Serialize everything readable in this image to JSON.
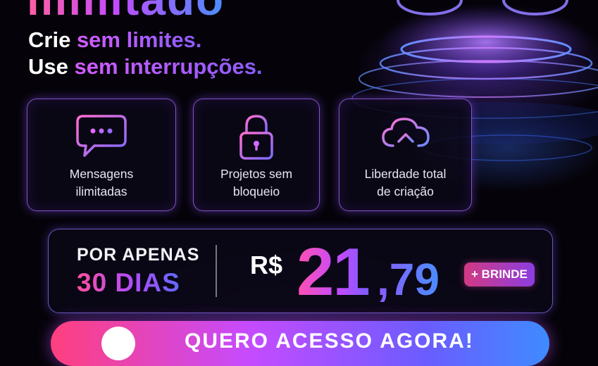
{
  "logo": {
    "text": "ilimitado"
  },
  "headline": {
    "line1_prefix": "Crie",
    "line1_highlight": "sem limites.",
    "line2_prefix": "Use",
    "line2_highlight": "sem interrupções."
  },
  "features": [
    {
      "icon": "chat-bubble-icon",
      "line1": "Mensagens",
      "line2": "ilimitadas"
    },
    {
      "icon": "padlock-icon",
      "line1": "Projetos sem",
      "line2": "bloqueio"
    },
    {
      "icon": "cloud-upload-icon",
      "line1": "Liberdade total",
      "line2": "de criação"
    }
  ],
  "offer": {
    "label_top": "POR APENAS",
    "label_bottom": "30 DIAS",
    "currency": "R$",
    "price_int": "21",
    "price_cents": ",79",
    "bonus_badge": "+ BRINDE"
  },
  "cta": {
    "label": "QUERO ACESSO AGORA!"
  },
  "colors": {
    "pink": "#ff4fa1",
    "purple": "#b04cff",
    "blue": "#4a8dff",
    "background": "#050309"
  }
}
